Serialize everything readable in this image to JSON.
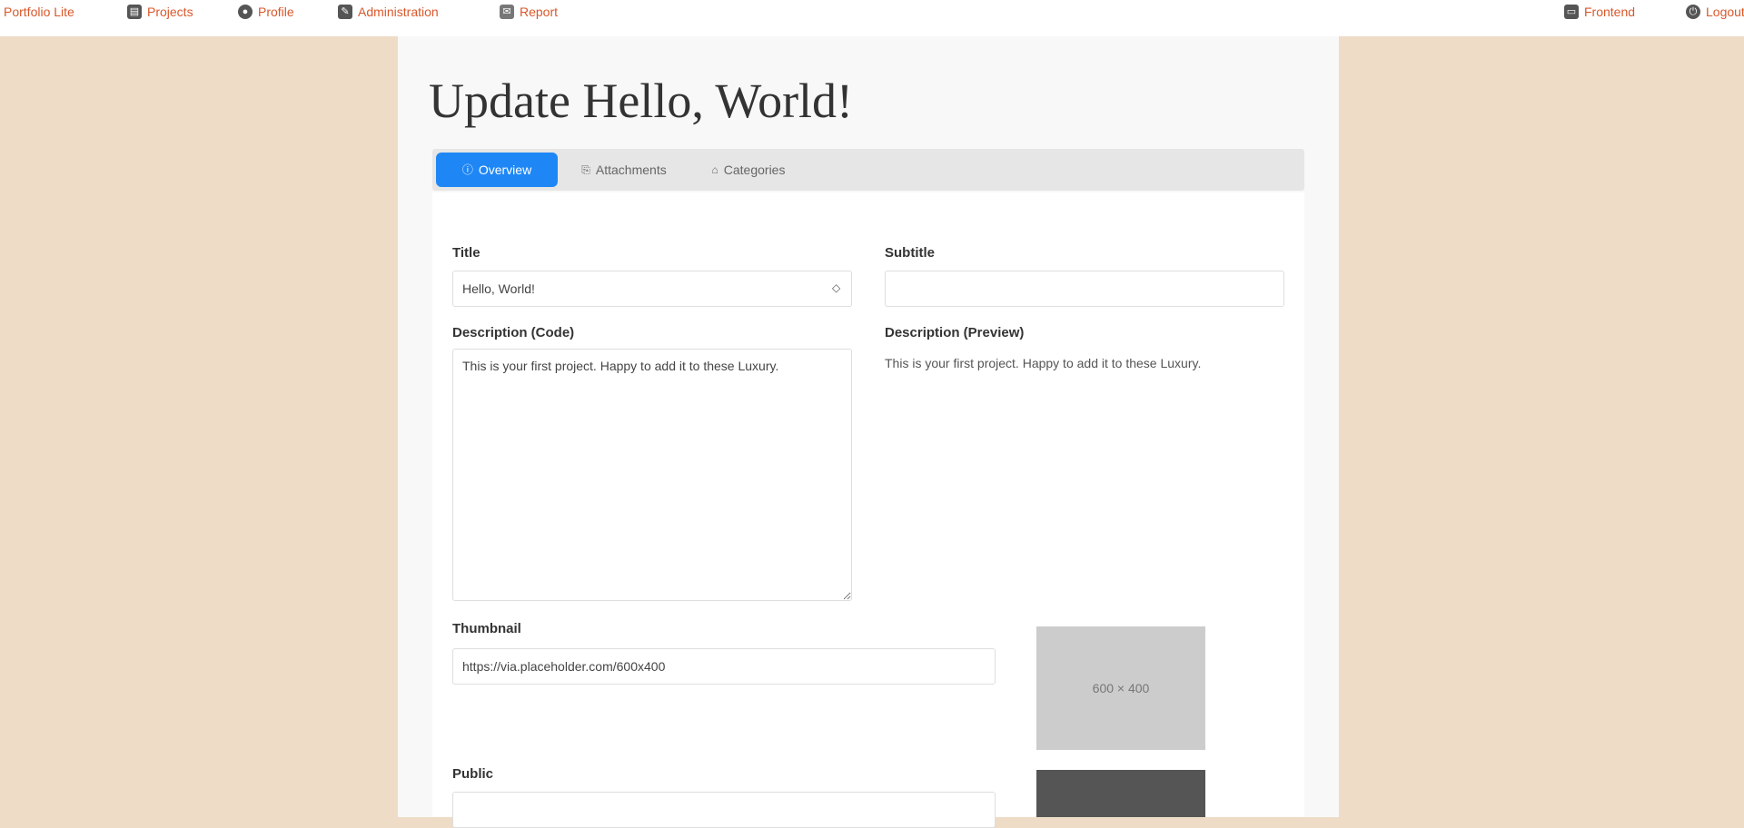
{
  "nav": {
    "brand": "Portfolio Lite",
    "items": [
      {
        "label": "Projects",
        "icon": "projects-icon"
      },
      {
        "label": "Profile",
        "icon": "user-icon"
      },
      {
        "label": "Administration",
        "icon": "wrench-icon"
      },
      {
        "label": "Report",
        "icon": "comment-icon"
      }
    ],
    "right": [
      {
        "label": "Frontend",
        "icon": "monitor-icon"
      },
      {
        "label": "Logout",
        "icon": "logout-icon"
      }
    ]
  },
  "page": {
    "title": "Update Hello, World!"
  },
  "tabs": [
    {
      "label": "Overview",
      "icon": "info-icon",
      "active": true
    },
    {
      "label": "Attachments",
      "icon": "paperclip-icon",
      "active": false
    },
    {
      "label": "Categories",
      "icon": "tag-icon",
      "active": false
    }
  ],
  "form": {
    "title_label": "Title",
    "title_value": "Hello, World!",
    "subtitle_label": "Subtitle",
    "subtitle_value": "",
    "desc_label": "Description (Code)",
    "desc_value": "This is your first project. Happy to add it to these Luxury.",
    "preview_label": "Description (Preview)",
    "preview_value": "This is your first project. Happy to add it to these Luxury.",
    "thumbnail_label": "Thumbnail",
    "thumbnail_value": "https://via.placeholder.com/600x400",
    "thumb_preview_text": "600 × 400",
    "field2_label": "Public",
    "field2_value": ""
  }
}
